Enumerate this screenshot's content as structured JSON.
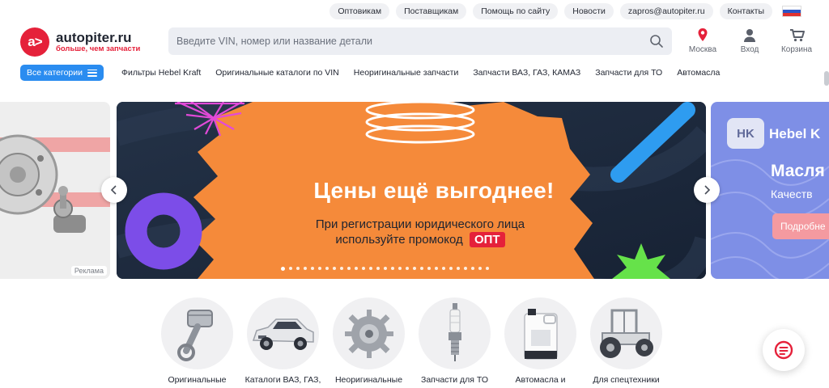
{
  "top_links": [
    "Оптовикам",
    "Поставщикам",
    "Помощь по сайту",
    "Новости",
    "zapros@autopiter.ru",
    "Контакты"
  ],
  "logo": {
    "mark": "a>",
    "brand": "autopiter.ru",
    "tagline": "больше, чем запчасти"
  },
  "search": {
    "placeholder": "Введите VIN, номер или название детали"
  },
  "header_actions": {
    "city": "Москва",
    "login": "Вход",
    "cart": "Корзина"
  },
  "nav": {
    "all_categories": "Все категории",
    "items": [
      "Фильтры Hebel Kraft",
      "Оригинальные каталоги по VIN",
      "Неоригинальные запчасти",
      "Запчасти ВАЗ, ГАЗ, КАМАЗ",
      "Запчасти для ТО",
      "Автомасла"
    ]
  },
  "carousel": {
    "left_slide_badge": "Реклама",
    "main": {
      "title": "Цены ещё выгоднее!",
      "subtitle_line1": "При регистрации юридического лица",
      "subtitle_line2": "используйте промокод",
      "promo_code": "ОПТ"
    },
    "right_slide": {
      "logo": "HK",
      "brand": "Hebel K",
      "title": "Масля",
      "subtitle": "Качеств",
      "button": "Подробне"
    },
    "dot_count": 29,
    "active_dot": 1
  },
  "categories": [
    {
      "label": "Оригинальные",
      "icon": "piston-icon"
    },
    {
      "label": "Каталоги ВАЗ, ГАЗ,",
      "icon": "car-icon"
    },
    {
      "label": "Неоригинальные",
      "icon": "gear-icon"
    },
    {
      "label": "Запчасти для ТО",
      "icon": "spark-plug-icon"
    },
    {
      "label": "Автомасла и",
      "icon": "oil-canister-icon"
    },
    {
      "label": "Для спецтехники",
      "icon": "tractor-icon"
    }
  ],
  "colors": {
    "brand_red": "#e5213a",
    "accent_blue": "#2a8cf0",
    "promo_orange": "#f58a3a",
    "banner_dark": "#1e2a3c"
  }
}
